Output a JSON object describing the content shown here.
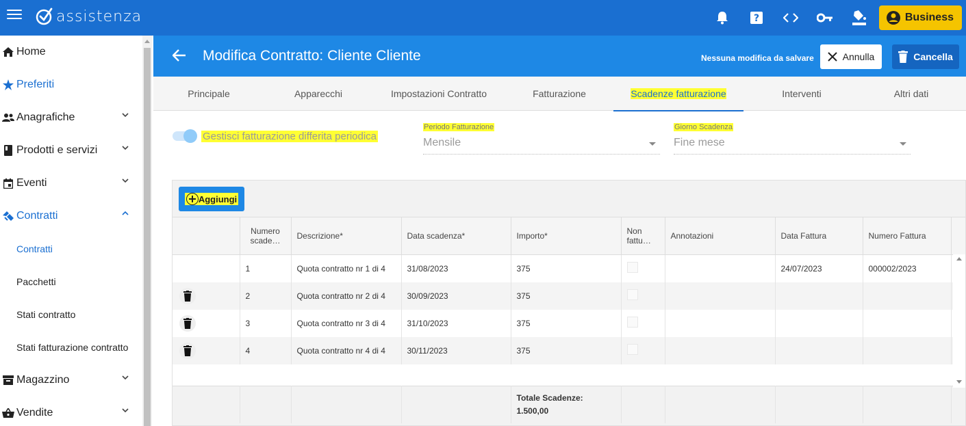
{
  "app": {
    "logo_text": "assistenza"
  },
  "topbar": {
    "business_label": "Business"
  },
  "sidebar": {
    "items": [
      {
        "label": "Home"
      },
      {
        "label": "Preferiti"
      },
      {
        "label": "Anagrafiche"
      },
      {
        "label": "Prodotti e servizi"
      },
      {
        "label": "Eventi"
      },
      {
        "label": "Contratti"
      },
      {
        "label": "Magazzino"
      },
      {
        "label": "Vendite"
      }
    ],
    "contratti_sub": [
      {
        "label": "Contratti"
      },
      {
        "label": "Pacchetti"
      },
      {
        "label": "Stati contratto"
      },
      {
        "label": "Stati fatturazione contratto"
      }
    ]
  },
  "header": {
    "title": "Modifica Contratto: Cliente Cliente",
    "status": "Nessuna modifica da salvare",
    "annulla_label": "Annulla",
    "cancella_label": "Cancella"
  },
  "tabs": [
    {
      "label": "Principale"
    },
    {
      "label": "Apparecchi"
    },
    {
      "label": "Impostazioni Contratto"
    },
    {
      "label": "Fatturazione"
    },
    {
      "label": "Scadenze fatturazione"
    },
    {
      "label": "Interventi"
    },
    {
      "label": "Altri dati"
    }
  ],
  "form": {
    "toggle_label": "Gestisci fatturazione differita periodica",
    "periodo_label": "Periodo Fatturazione",
    "periodo_value": "Mensile",
    "giorno_label": "Giorno Scadenza",
    "giorno_value": "Fine mese"
  },
  "grid": {
    "add_label": "Aggiungi",
    "headers": {
      "numero": "Numero scade…",
      "descrizione": "Descrizione*",
      "data_scadenza": "Data scadenza*",
      "importo": "Importo*",
      "non_fatturare": "Non fattu…",
      "annotazioni": "Annotazioni",
      "data_fattura": "Data Fattura",
      "numero_fattura": "Numero Fattura"
    },
    "rows": [
      {
        "numero": "1",
        "descrizione": "Quota contratto nr 1 di 4",
        "data": "31/08/2023",
        "importo": "375",
        "annotazioni": "",
        "data_fattura": "24/07/2023",
        "numero_fattura": "000002/2023"
      },
      {
        "numero": "2",
        "descrizione": "Quota contratto nr 2 di 4",
        "data": "30/09/2023",
        "importo": "375",
        "annotazioni": "",
        "data_fattura": "",
        "numero_fattura": ""
      },
      {
        "numero": "3",
        "descrizione": "Quota contratto nr 3 di 4",
        "data": "31/10/2023",
        "importo": "375",
        "annotazioni": "",
        "data_fattura": "",
        "numero_fattura": ""
      },
      {
        "numero": "4",
        "descrizione": "Quota contratto nr 4 di 4",
        "data": "30/11/2023",
        "importo": "375",
        "annotazioni": "",
        "data_fattura": "",
        "numero_fattura": ""
      }
    ],
    "footer": {
      "totale_label": "Totale Scadenze:",
      "totale_value": "1.500,00"
    }
  },
  "colors": {
    "primary": "#1a6fd1",
    "header": "#1e88e5",
    "business": "#f5c400",
    "highlight": "#ffff33"
  }
}
